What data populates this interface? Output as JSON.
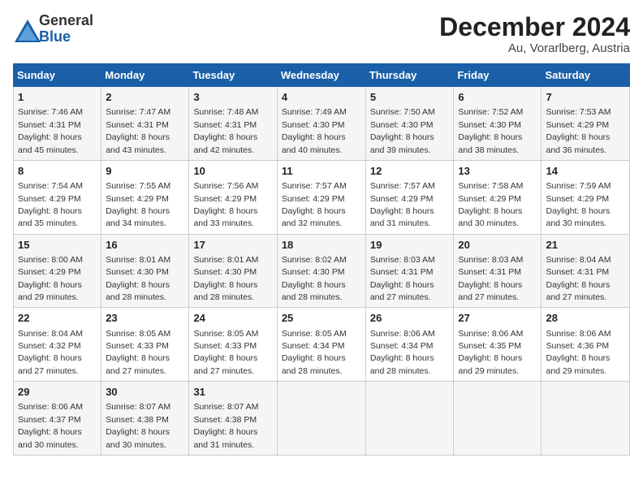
{
  "header": {
    "logo_general": "General",
    "logo_blue": "Blue",
    "title": "December 2024",
    "subtitle": "Au, Vorarlberg, Austria"
  },
  "columns": [
    "Sunday",
    "Monday",
    "Tuesday",
    "Wednesday",
    "Thursday",
    "Friday",
    "Saturday"
  ],
  "weeks": [
    [
      {
        "day": "1",
        "sunrise": "Sunrise: 7:46 AM",
        "sunset": "Sunset: 4:31 PM",
        "daylight": "Daylight: 8 hours and 45 minutes."
      },
      {
        "day": "2",
        "sunrise": "Sunrise: 7:47 AM",
        "sunset": "Sunset: 4:31 PM",
        "daylight": "Daylight: 8 hours and 43 minutes."
      },
      {
        "day": "3",
        "sunrise": "Sunrise: 7:48 AM",
        "sunset": "Sunset: 4:31 PM",
        "daylight": "Daylight: 8 hours and 42 minutes."
      },
      {
        "day": "4",
        "sunrise": "Sunrise: 7:49 AM",
        "sunset": "Sunset: 4:30 PM",
        "daylight": "Daylight: 8 hours and 40 minutes."
      },
      {
        "day": "5",
        "sunrise": "Sunrise: 7:50 AM",
        "sunset": "Sunset: 4:30 PM",
        "daylight": "Daylight: 8 hours and 39 minutes."
      },
      {
        "day": "6",
        "sunrise": "Sunrise: 7:52 AM",
        "sunset": "Sunset: 4:30 PM",
        "daylight": "Daylight: 8 hours and 38 minutes."
      },
      {
        "day": "7",
        "sunrise": "Sunrise: 7:53 AM",
        "sunset": "Sunset: 4:29 PM",
        "daylight": "Daylight: 8 hours and 36 minutes."
      }
    ],
    [
      {
        "day": "8",
        "sunrise": "Sunrise: 7:54 AM",
        "sunset": "Sunset: 4:29 PM",
        "daylight": "Daylight: 8 hours and 35 minutes."
      },
      {
        "day": "9",
        "sunrise": "Sunrise: 7:55 AM",
        "sunset": "Sunset: 4:29 PM",
        "daylight": "Daylight: 8 hours and 34 minutes."
      },
      {
        "day": "10",
        "sunrise": "Sunrise: 7:56 AM",
        "sunset": "Sunset: 4:29 PM",
        "daylight": "Daylight: 8 hours and 33 minutes."
      },
      {
        "day": "11",
        "sunrise": "Sunrise: 7:57 AM",
        "sunset": "Sunset: 4:29 PM",
        "daylight": "Daylight: 8 hours and 32 minutes."
      },
      {
        "day": "12",
        "sunrise": "Sunrise: 7:57 AM",
        "sunset": "Sunset: 4:29 PM",
        "daylight": "Daylight: 8 hours and 31 minutes."
      },
      {
        "day": "13",
        "sunrise": "Sunrise: 7:58 AM",
        "sunset": "Sunset: 4:29 PM",
        "daylight": "Daylight: 8 hours and 30 minutes."
      },
      {
        "day": "14",
        "sunrise": "Sunrise: 7:59 AM",
        "sunset": "Sunset: 4:29 PM",
        "daylight": "Daylight: 8 hours and 30 minutes."
      }
    ],
    [
      {
        "day": "15",
        "sunrise": "Sunrise: 8:00 AM",
        "sunset": "Sunset: 4:29 PM",
        "daylight": "Daylight: 8 hours and 29 minutes."
      },
      {
        "day": "16",
        "sunrise": "Sunrise: 8:01 AM",
        "sunset": "Sunset: 4:30 PM",
        "daylight": "Daylight: 8 hours and 28 minutes."
      },
      {
        "day": "17",
        "sunrise": "Sunrise: 8:01 AM",
        "sunset": "Sunset: 4:30 PM",
        "daylight": "Daylight: 8 hours and 28 minutes."
      },
      {
        "day": "18",
        "sunrise": "Sunrise: 8:02 AM",
        "sunset": "Sunset: 4:30 PM",
        "daylight": "Daylight: 8 hours and 28 minutes."
      },
      {
        "day": "19",
        "sunrise": "Sunrise: 8:03 AM",
        "sunset": "Sunset: 4:31 PM",
        "daylight": "Daylight: 8 hours and 27 minutes."
      },
      {
        "day": "20",
        "sunrise": "Sunrise: 8:03 AM",
        "sunset": "Sunset: 4:31 PM",
        "daylight": "Daylight: 8 hours and 27 minutes."
      },
      {
        "day": "21",
        "sunrise": "Sunrise: 8:04 AM",
        "sunset": "Sunset: 4:31 PM",
        "daylight": "Daylight: 8 hours and 27 minutes."
      }
    ],
    [
      {
        "day": "22",
        "sunrise": "Sunrise: 8:04 AM",
        "sunset": "Sunset: 4:32 PM",
        "daylight": "Daylight: 8 hours and 27 minutes."
      },
      {
        "day": "23",
        "sunrise": "Sunrise: 8:05 AM",
        "sunset": "Sunset: 4:33 PM",
        "daylight": "Daylight: 8 hours and 27 minutes."
      },
      {
        "day": "24",
        "sunrise": "Sunrise: 8:05 AM",
        "sunset": "Sunset: 4:33 PM",
        "daylight": "Daylight: 8 hours and 27 minutes."
      },
      {
        "day": "25",
        "sunrise": "Sunrise: 8:05 AM",
        "sunset": "Sunset: 4:34 PM",
        "daylight": "Daylight: 8 hours and 28 minutes."
      },
      {
        "day": "26",
        "sunrise": "Sunrise: 8:06 AM",
        "sunset": "Sunset: 4:34 PM",
        "daylight": "Daylight: 8 hours and 28 minutes."
      },
      {
        "day": "27",
        "sunrise": "Sunrise: 8:06 AM",
        "sunset": "Sunset: 4:35 PM",
        "daylight": "Daylight: 8 hours and 29 minutes."
      },
      {
        "day": "28",
        "sunrise": "Sunrise: 8:06 AM",
        "sunset": "Sunset: 4:36 PM",
        "daylight": "Daylight: 8 hours and 29 minutes."
      }
    ],
    [
      {
        "day": "29",
        "sunrise": "Sunrise: 8:06 AM",
        "sunset": "Sunset: 4:37 PM",
        "daylight": "Daylight: 8 hours and 30 minutes."
      },
      {
        "day": "30",
        "sunrise": "Sunrise: 8:07 AM",
        "sunset": "Sunset: 4:38 PM",
        "daylight": "Daylight: 8 hours and 30 minutes."
      },
      {
        "day": "31",
        "sunrise": "Sunrise: 8:07 AM",
        "sunset": "Sunset: 4:38 PM",
        "daylight": "Daylight: 8 hours and 31 minutes."
      },
      null,
      null,
      null,
      null
    ]
  ]
}
